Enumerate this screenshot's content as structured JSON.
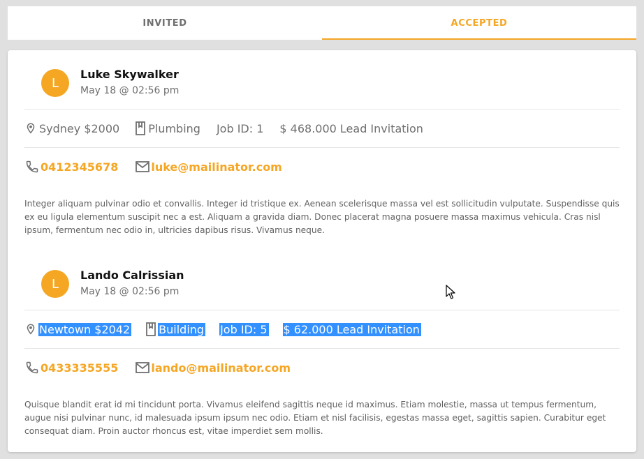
{
  "tabs": [
    {
      "label": "INVITED",
      "active": false
    },
    {
      "label": "ACCEPTED",
      "active": true
    }
  ],
  "accent_color": "#f5a623",
  "entries": [
    {
      "avatar_letter": "L",
      "name": "Luke Skywalker",
      "date": "May 18 @ 02:56 pm",
      "location": "Sydney $2000",
      "category": "Plumbing",
      "job_id": "Job ID: 1",
      "lead": "$ 468.000 Lead Invitation",
      "phone": "0412345678",
      "email": "luke@mailinator.com",
      "description": "Integer aliquam pulvinar odio et convallis. Integer id tristique ex. Aenean scelerisque massa vel est sollicitudin vulputate. Suspendisse quis ex eu ligula elementum suscipit nec a est. Aliquam a gravida diam. Donec placerat magna posuere massa maximus vehicula. Cras nisl ipsum, fermentum nec odio in, ultricies dapibus risus. Vivamus neque."
    },
    {
      "avatar_letter": "L",
      "name": "Lando Calrissian",
      "date": "May 18 @ 02:56 pm",
      "location": "Newtown $2042",
      "category": "Building",
      "job_id": "Job ID: 5",
      "lead": "$ 62.000 Lead Invitation",
      "phone": "0433335555",
      "email": "lando@mailinator.com",
      "description": "Quisque blandit erat id mi tincidunt porta. Vivamus eleifend sagittis neque id maximus. Etiam molestie, massa ut tempus fermentum, augue nisi pulvinar nunc, id malesuada ipsum ipsum nec odio. Etiam et nisl facilisis, egestas massa eget, sagittis sapien. Curabitur eget consequat diam. Proin auctor rhoncus est, vitae imperdiet sem mollis."
    }
  ]
}
